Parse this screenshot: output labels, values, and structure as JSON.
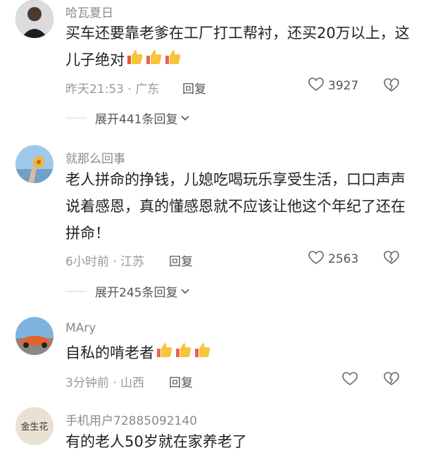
{
  "comments": [
    {
      "username": "哈瓦夏日",
      "content": "买车还要靠老爹在工厂打工帮衬，还买20万以上，这儿子绝对",
      "emoji": [
        "thumbs-up",
        "thumbs-up",
        "thumbs-up"
      ],
      "time": "昨天21:53",
      "location": "广东",
      "reply_label": "回复",
      "likes": "3927",
      "expand": "展开441条回复"
    },
    {
      "username": "就那么回事",
      "content": "老人拼命的挣钱，儿媳吃喝玩乐享受生活，口口声声说着感恩，真的懂感恩就不应该让他这个年纪了还在拼命！",
      "emoji": [],
      "time": "6小时前",
      "location": "江苏",
      "reply_label": "回复",
      "likes": "2563",
      "expand": "展开245条回复"
    },
    {
      "username": "MAry",
      "content": "自私的啃老者",
      "emoji": [
        "thumbs-up",
        "thumbs-up",
        "thumbs-up"
      ],
      "time": "3分钟前",
      "location": "山西",
      "reply_label": "回复",
      "likes": ""
    },
    {
      "username": "手机用户72885092140",
      "content": "有的老人50岁就在家养老了",
      "avatar_text": "金生花"
    }
  ],
  "separator": " · ",
  "colors": {
    "meta": "#999999",
    "username": "#8a8a8a",
    "text": "#222222",
    "emoji": "#f5b31e"
  }
}
